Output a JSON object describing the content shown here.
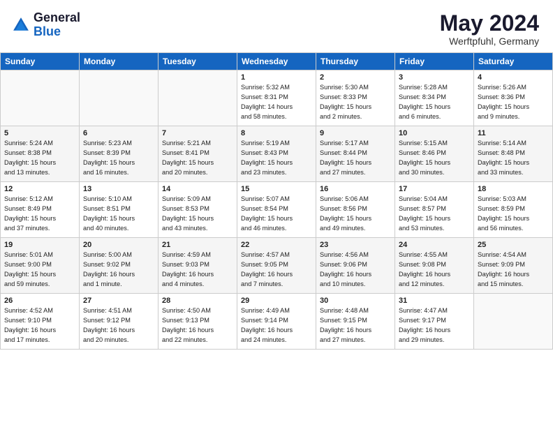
{
  "header": {
    "logo_line1": "General",
    "logo_line2": "Blue",
    "title": "May 2024",
    "subtitle": "Werftpfuhl, Germany"
  },
  "days_of_week": [
    "Sunday",
    "Monday",
    "Tuesday",
    "Wednesday",
    "Thursday",
    "Friday",
    "Saturday"
  ],
  "weeks": [
    [
      {
        "num": "",
        "info": ""
      },
      {
        "num": "",
        "info": ""
      },
      {
        "num": "",
        "info": ""
      },
      {
        "num": "1",
        "info": "Sunrise: 5:32 AM\nSunset: 8:31 PM\nDaylight: 14 hours\nand 58 minutes."
      },
      {
        "num": "2",
        "info": "Sunrise: 5:30 AM\nSunset: 8:33 PM\nDaylight: 15 hours\nand 2 minutes."
      },
      {
        "num": "3",
        "info": "Sunrise: 5:28 AM\nSunset: 8:34 PM\nDaylight: 15 hours\nand 6 minutes."
      },
      {
        "num": "4",
        "info": "Sunrise: 5:26 AM\nSunset: 8:36 PM\nDaylight: 15 hours\nand 9 minutes."
      }
    ],
    [
      {
        "num": "5",
        "info": "Sunrise: 5:24 AM\nSunset: 8:38 PM\nDaylight: 15 hours\nand 13 minutes."
      },
      {
        "num": "6",
        "info": "Sunrise: 5:23 AM\nSunset: 8:39 PM\nDaylight: 15 hours\nand 16 minutes."
      },
      {
        "num": "7",
        "info": "Sunrise: 5:21 AM\nSunset: 8:41 PM\nDaylight: 15 hours\nand 20 minutes."
      },
      {
        "num": "8",
        "info": "Sunrise: 5:19 AM\nSunset: 8:43 PM\nDaylight: 15 hours\nand 23 minutes."
      },
      {
        "num": "9",
        "info": "Sunrise: 5:17 AM\nSunset: 8:44 PM\nDaylight: 15 hours\nand 27 minutes."
      },
      {
        "num": "10",
        "info": "Sunrise: 5:15 AM\nSunset: 8:46 PM\nDaylight: 15 hours\nand 30 minutes."
      },
      {
        "num": "11",
        "info": "Sunrise: 5:14 AM\nSunset: 8:48 PM\nDaylight: 15 hours\nand 33 minutes."
      }
    ],
    [
      {
        "num": "12",
        "info": "Sunrise: 5:12 AM\nSunset: 8:49 PM\nDaylight: 15 hours\nand 37 minutes."
      },
      {
        "num": "13",
        "info": "Sunrise: 5:10 AM\nSunset: 8:51 PM\nDaylight: 15 hours\nand 40 minutes."
      },
      {
        "num": "14",
        "info": "Sunrise: 5:09 AM\nSunset: 8:53 PM\nDaylight: 15 hours\nand 43 minutes."
      },
      {
        "num": "15",
        "info": "Sunrise: 5:07 AM\nSunset: 8:54 PM\nDaylight: 15 hours\nand 46 minutes."
      },
      {
        "num": "16",
        "info": "Sunrise: 5:06 AM\nSunset: 8:56 PM\nDaylight: 15 hours\nand 49 minutes."
      },
      {
        "num": "17",
        "info": "Sunrise: 5:04 AM\nSunset: 8:57 PM\nDaylight: 15 hours\nand 53 minutes."
      },
      {
        "num": "18",
        "info": "Sunrise: 5:03 AM\nSunset: 8:59 PM\nDaylight: 15 hours\nand 56 minutes."
      }
    ],
    [
      {
        "num": "19",
        "info": "Sunrise: 5:01 AM\nSunset: 9:00 PM\nDaylight: 15 hours\nand 59 minutes."
      },
      {
        "num": "20",
        "info": "Sunrise: 5:00 AM\nSunset: 9:02 PM\nDaylight: 16 hours\nand 1 minute."
      },
      {
        "num": "21",
        "info": "Sunrise: 4:59 AM\nSunset: 9:03 PM\nDaylight: 16 hours\nand 4 minutes."
      },
      {
        "num": "22",
        "info": "Sunrise: 4:57 AM\nSunset: 9:05 PM\nDaylight: 16 hours\nand 7 minutes."
      },
      {
        "num": "23",
        "info": "Sunrise: 4:56 AM\nSunset: 9:06 PM\nDaylight: 16 hours\nand 10 minutes."
      },
      {
        "num": "24",
        "info": "Sunrise: 4:55 AM\nSunset: 9:08 PM\nDaylight: 16 hours\nand 12 minutes."
      },
      {
        "num": "25",
        "info": "Sunrise: 4:54 AM\nSunset: 9:09 PM\nDaylight: 16 hours\nand 15 minutes."
      }
    ],
    [
      {
        "num": "26",
        "info": "Sunrise: 4:52 AM\nSunset: 9:10 PM\nDaylight: 16 hours\nand 17 minutes."
      },
      {
        "num": "27",
        "info": "Sunrise: 4:51 AM\nSunset: 9:12 PM\nDaylight: 16 hours\nand 20 minutes."
      },
      {
        "num": "28",
        "info": "Sunrise: 4:50 AM\nSunset: 9:13 PM\nDaylight: 16 hours\nand 22 minutes."
      },
      {
        "num": "29",
        "info": "Sunrise: 4:49 AM\nSunset: 9:14 PM\nDaylight: 16 hours\nand 24 minutes."
      },
      {
        "num": "30",
        "info": "Sunrise: 4:48 AM\nSunset: 9:15 PM\nDaylight: 16 hours\nand 27 minutes."
      },
      {
        "num": "31",
        "info": "Sunrise: 4:47 AM\nSunset: 9:17 PM\nDaylight: 16 hours\nand 29 minutes."
      },
      {
        "num": "",
        "info": ""
      }
    ]
  ]
}
